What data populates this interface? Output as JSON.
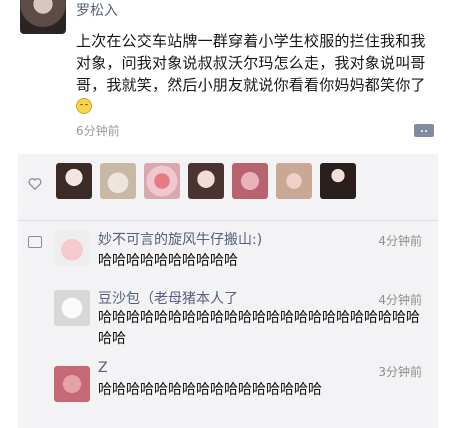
{
  "post": {
    "author": "罗松入",
    "text": "上次在公交车站牌一群穿着小学生校服的拦住我和我对象，问我对象说叔叔沃尔玛怎么走，我对象说叫哥哥，我就笑，然后小朋友就说你看看你妈妈都笑你了",
    "emoji": "smile-emoji",
    "time": "6分钟前"
  },
  "likes": {
    "count_avatars": 7
  },
  "comments": [
    {
      "name": "妙不可言的旋风牛仔搬山:)",
      "time": "4分钟前",
      "text": "哈哈哈哈哈哈哈哈哈哈"
    },
    {
      "name": "豆沙包（老母猪本人了",
      "time": "4分钟前",
      "text": "哈哈哈哈哈哈哈哈哈哈哈哈哈哈哈哈哈哈哈哈哈哈哈哈哈"
    },
    {
      "name": "Z",
      "time": "3分钟前",
      "text": "哈哈哈哈哈哈哈哈哈哈哈哈哈哈哈哈"
    }
  ],
  "colors": {
    "name_blue": "#55607e",
    "panel_bg": "#f3f3f5"
  }
}
